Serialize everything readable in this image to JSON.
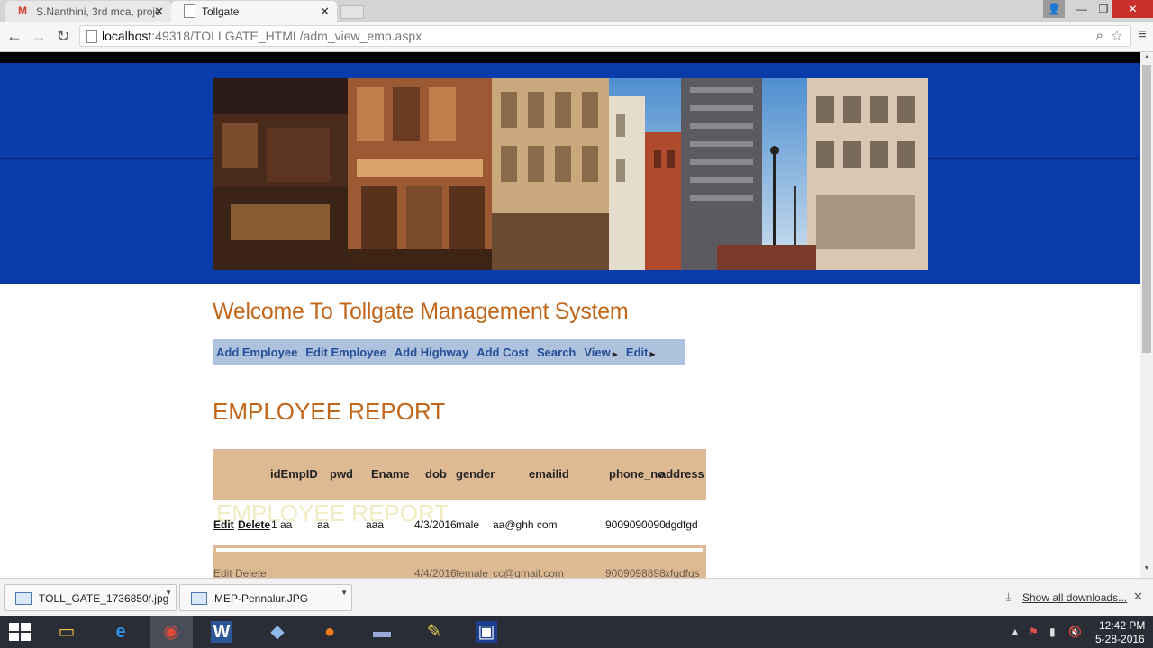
{
  "browser": {
    "tabs": [
      {
        "title": "S.Nanthini, 3rd mca, proje",
        "active": false
      },
      {
        "title": "Tollgate",
        "active": true
      }
    ],
    "url_host": "localhost",
    "url_path": ":49318/TOLLGATE_HTML/adm_view_emp.aspx"
  },
  "page": {
    "welcome": "Welcome To Tollgate Management System",
    "menu": [
      {
        "label": "Add Employee",
        "has_submenu": false
      },
      {
        "label": "Edit Employee",
        "has_submenu": false
      },
      {
        "label": "Add Highway",
        "has_submenu": false
      },
      {
        "label": "Add Cost",
        "has_submenu": false
      },
      {
        "label": "Search",
        "has_submenu": false
      },
      {
        "label": "View",
        "has_submenu": true
      },
      {
        "label": "Edit",
        "has_submenu": true
      }
    ],
    "report_title": "EMPLOYEE REPORT",
    "ghost_title": "EMPLOYEE REPORT",
    "columns": [
      "idEmpID",
      "pwd",
      "Ename",
      "dob",
      "gender",
      "emailid",
      "phone_no",
      "address"
    ],
    "row_actions": {
      "edit": "Edit",
      "delete": "Delete"
    },
    "rows": [
      {
        "id": "1",
        "pwd": "aa",
        "ename": "aaa",
        "dob": "4/3/2016",
        "gender": "male",
        "email": "aa@ghh com",
        "phone": "9009090090",
        "address": "dgdfgd"
      },
      {
        "id": "",
        "pwd": "",
        "ename": "",
        "dob": "4/4/2016",
        "gender": "female",
        "email": "cc@gmail.com",
        "phone": "9009098898",
        "address": "xfgdfgs"
      }
    ],
    "row2_actions": "Edit Delete",
    "status_url": "...sss_default/f?SPVCon-r/..."
  },
  "downloads": {
    "items": [
      "TOLL_GATE_1736850f.jpg",
      "MEP-Pennalur.JPG"
    ],
    "show_all": "Show all downloads..."
  },
  "taskbar": {
    "time": "12:42 PM",
    "date": "5-28-2016",
    "apps": [
      "file-explorer",
      "internet-explorer",
      "chrome",
      "word",
      "app-cube",
      "firefox",
      "app-5",
      "app-6",
      "app-7"
    ]
  },
  "colors": {
    "header_blue": "#0a3bab",
    "heading_orange": "#c2661a",
    "menu_bg": "#aec2de",
    "menu_text": "#284e98",
    "grid_header_bg": "#deba94"
  }
}
